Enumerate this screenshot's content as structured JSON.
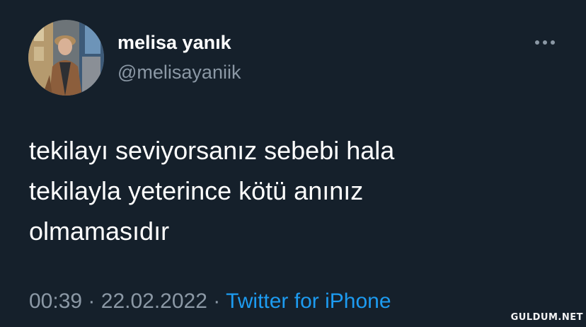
{
  "user": {
    "display_name": "melisa yanık",
    "handle": "@melisayaniik",
    "avatar_icon": "profile-photo"
  },
  "more_icon": "more-horizontal-icon",
  "tweet": {
    "lines": [
      "tekilayı seviyorsanız sebebi hala",
      "tekilayla yeterince kötü anınız",
      "olmamasıdır"
    ]
  },
  "meta": {
    "time": "00:39",
    "separator": "·",
    "date": "22.02.2022",
    "source": "Twitter for iPhone"
  },
  "watermark": "GULDUM.NET",
  "colors": {
    "background": "#15202b",
    "primary_text": "#ffffff",
    "secondary_text": "#8b98a5",
    "link": "#1d9bf0"
  }
}
